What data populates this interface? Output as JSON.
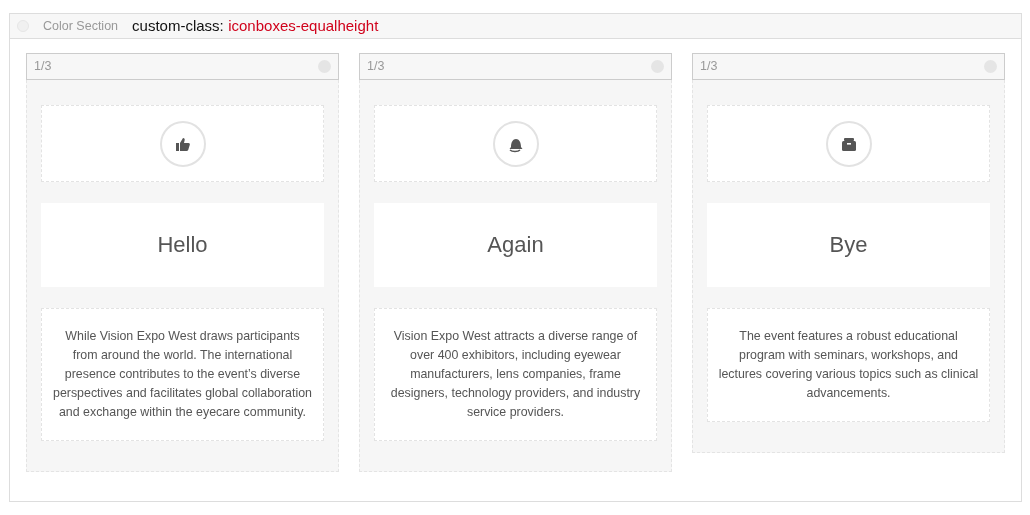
{
  "section": {
    "label": "Color Section",
    "custom_class_label": "custom-class:",
    "custom_class_value": "iconboxes-equalheight"
  },
  "columns": [
    {
      "width_label": "1/3",
      "heading": "Hello",
      "text": "While Vision Expo West draws participants from around the world. The international presence contributes to the event’s diverse perspectives and facilitates global collaboration and exchange within the eyecare community."
    },
    {
      "width_label": "1/3",
      "heading": "Again",
      "text": "Vision Expo West attracts a diverse range of over 400 exhibitors, including eyewear manufacturers, lens companies, frame designers, technology providers, and industry service providers."
    },
    {
      "width_label": "1/3",
      "heading": "Bye",
      "text": "The event features a robust educational program with seminars, workshops, and lectures covering various topics such as clinical advancements."
    }
  ]
}
